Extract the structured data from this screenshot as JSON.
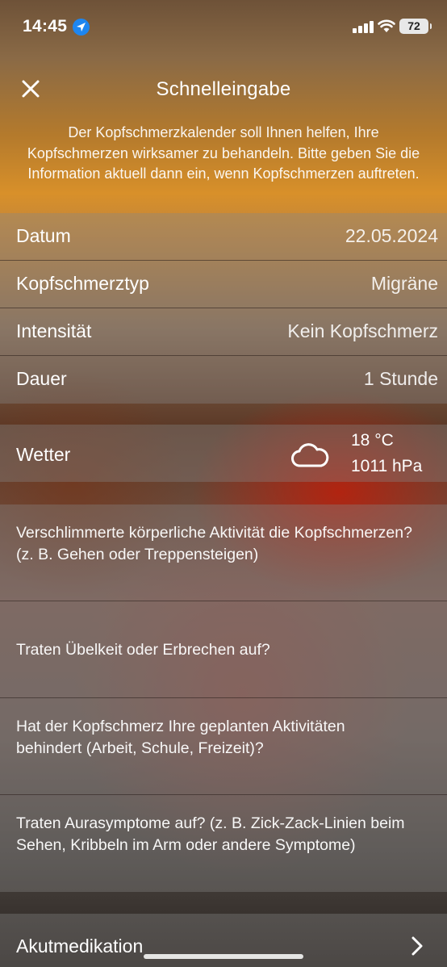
{
  "status_bar": {
    "time": "14:45",
    "battery": "72"
  },
  "header": {
    "title": "Schnelleingabe",
    "intro": "Der Kopfschmerzkalender soll Ihnen helfen, Ihre Kopfschmerzen wirksamer zu behandeln. Bitte geben Sie die Information aktuell dann ein, wenn Kopfschmerzen auftreten."
  },
  "fields": [
    {
      "label": "Datum",
      "value": "22.05.2024"
    },
    {
      "label": "Kopfschmerztyp",
      "value": "Migräne"
    },
    {
      "label": "Intensität",
      "value": "Kein Kopfschmerz"
    },
    {
      "label": "Dauer",
      "value": "1 Stunde"
    }
  ],
  "weather": {
    "label": "Wetter",
    "temperature": "18 °C",
    "pressure": "1011 hPa",
    "icon": "cloud-icon"
  },
  "questions": [
    "Verschlimmerte körperliche Aktivität die Kopfschmerzen? (z. B. Gehen oder Treppensteigen)",
    "Traten Übelkeit oder Erbrechen auf?",
    "Hat der Kopfschmerz Ihre geplanten Aktivitäten behindert (Arbeit, Schule, Freizeit)?",
    "Traten Aurasymptome auf? (z. B. Zick-Zack-Linien beim Sehen, Kribbeln im Arm oder andere Symptome)"
  ],
  "acute_medication": {
    "label": "Akutmedikation"
  }
}
